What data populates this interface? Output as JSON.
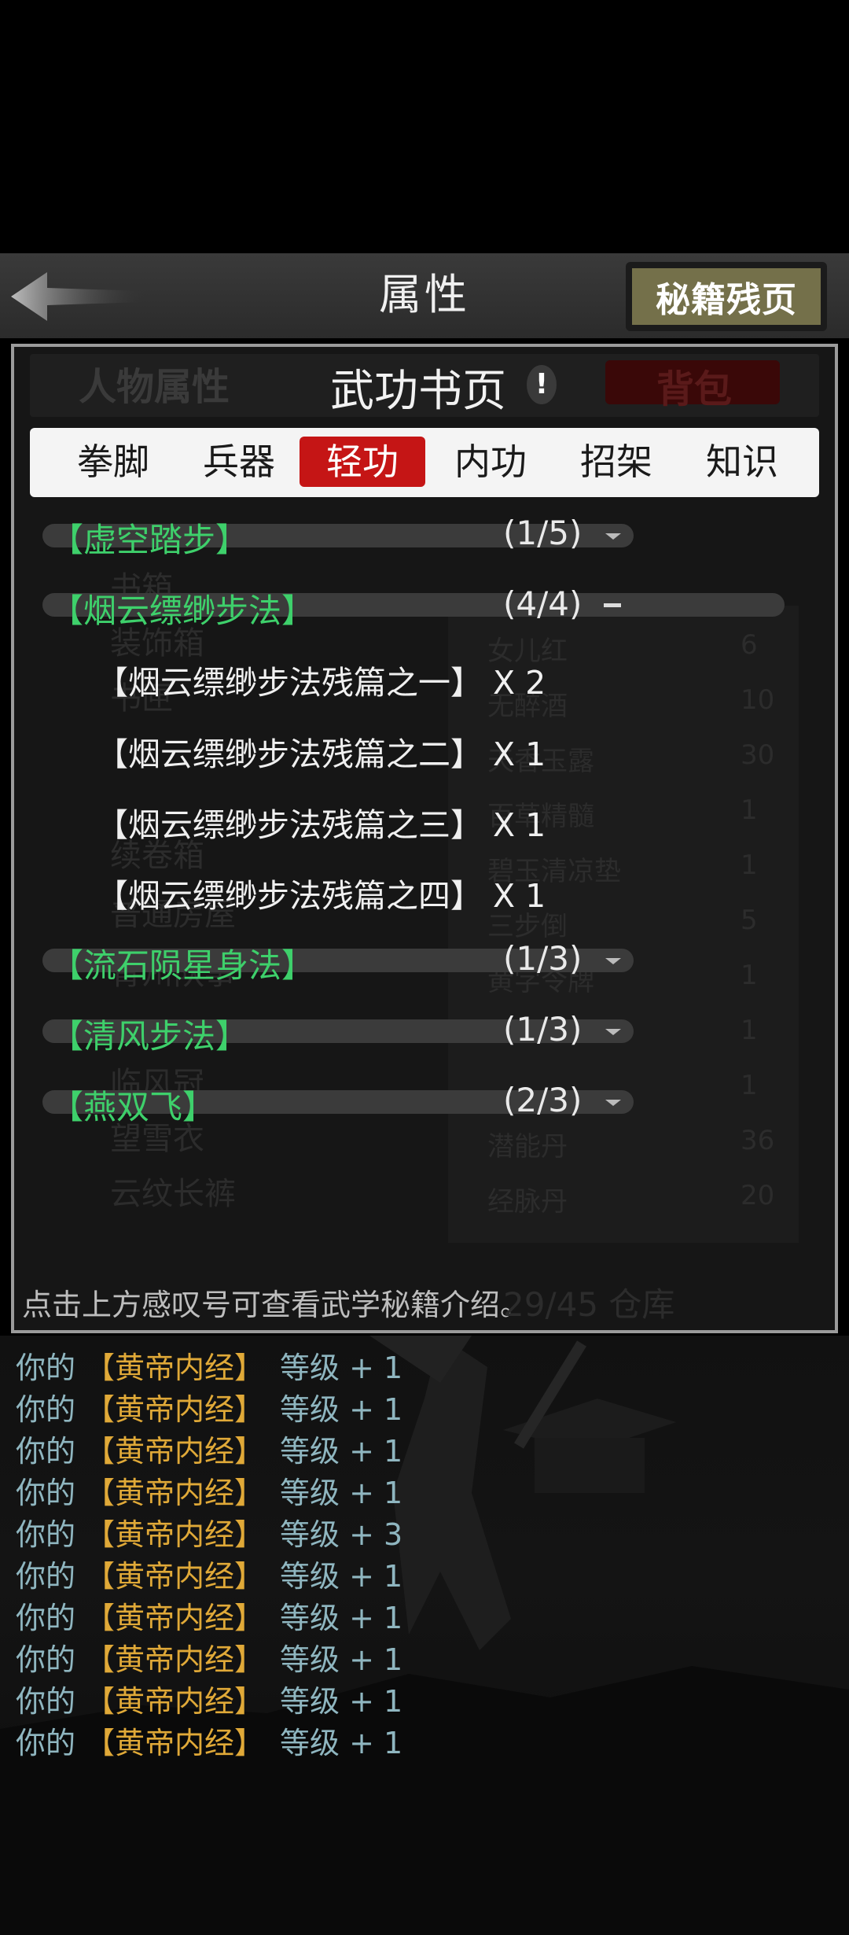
{
  "header": {
    "title": "属性",
    "fragments_button": "秘籍残页"
  },
  "panel": {
    "ghost_left_tab": "人物属性",
    "title": "武功书页",
    "info_mark": "!",
    "ghost_right_tab": "背包"
  },
  "tabs": [
    {
      "label": "拳脚",
      "active": false
    },
    {
      "label": "兵器",
      "active": false
    },
    {
      "label": "轻功",
      "active": true
    },
    {
      "label": "内功",
      "active": false
    },
    {
      "label": "招架",
      "active": false
    },
    {
      "label": "知识",
      "active": false
    }
  ],
  "groups": [
    {
      "name": "【虚空踏步】",
      "count": "(1/5)",
      "expanded": false
    },
    {
      "name": "【烟云缥缈步法】",
      "count": "(4/4)",
      "expanded": true,
      "items": [
        "【烟云缥缈步法残篇之一】 X 2",
        "【烟云缥缈步法残篇之二】 X 1",
        "【烟云缥缈步法残篇之三】 X 1",
        "【烟云缥缈步法残篇之四】 X 1"
      ]
    },
    {
      "name": "【流石陨星身法】",
      "count": "(1/3)",
      "expanded": false
    },
    {
      "name": "【清风步法】",
      "count": "(1/3)",
      "expanded": false
    },
    {
      "name": "【燕双飞】",
      "count": "(2/3)",
      "expanded": false
    }
  ],
  "hint": "点击上方感叹号可查看武学秘籍介绍。",
  "ghost_background": {
    "left": [
      "书箱",
      "装饰箱",
      "书匣",
      "续卷箱",
      "普通房屋",
      "青州队事",
      "临风冠",
      "望雪衣",
      "云纹长裤"
    ],
    "right": [
      {
        "name": "女儿红",
        "qty": "6"
      },
      {
        "name": "无醉酒",
        "qty": "10"
      },
      {
        "name": "天香玉露",
        "qty": "30"
      },
      {
        "name": "百草精髓",
        "qty": "1"
      },
      {
        "name": "碧玉清凉垫",
        "qty": "1"
      },
      {
        "name": "三步倒",
        "qty": "5"
      },
      {
        "name": "黄字令牌",
        "qty": "1"
      },
      {
        "name": "",
        "qty": "1"
      },
      {
        "name": "",
        "qty": "1"
      },
      {
        "name": "潜能丹",
        "qty": "36"
      },
      {
        "name": "经脉丹",
        "qty": "20"
      }
    ],
    "warehouse": "29/45 仓库"
  },
  "log": [
    {
      "prefix": "你的",
      "book": "【黄帝内经】",
      "suffix": "等级 + 1"
    },
    {
      "prefix": "你的",
      "book": "【黄帝内经】",
      "suffix": "等级 + 1"
    },
    {
      "prefix": "你的",
      "book": "【黄帝内经】",
      "suffix": "等级 + 1"
    },
    {
      "prefix": "你的",
      "book": "【黄帝内经】",
      "suffix": "等级 + 1"
    },
    {
      "prefix": "你的",
      "book": "【黄帝内经】",
      "suffix": "等级 + 3"
    },
    {
      "prefix": "你的",
      "book": "【黄帝内经】",
      "suffix": "等级 + 1"
    },
    {
      "prefix": "你的",
      "book": "【黄帝内经】",
      "suffix": "等级 + 1"
    },
    {
      "prefix": "你的",
      "book": "【黄帝内经】",
      "suffix": "等级 + 1"
    },
    {
      "prefix": "你的",
      "book": "【黄帝内经】",
      "suffix": "等级 + 1"
    },
    {
      "prefix": "你的",
      "book": "【黄帝内经】",
      "suffix": "等级 + 1"
    }
  ],
  "colors": {
    "group_name": "#3ed06b",
    "active_tab": "#c51515",
    "log_book": "#e0a938",
    "log_text": "#8fb6c0"
  }
}
